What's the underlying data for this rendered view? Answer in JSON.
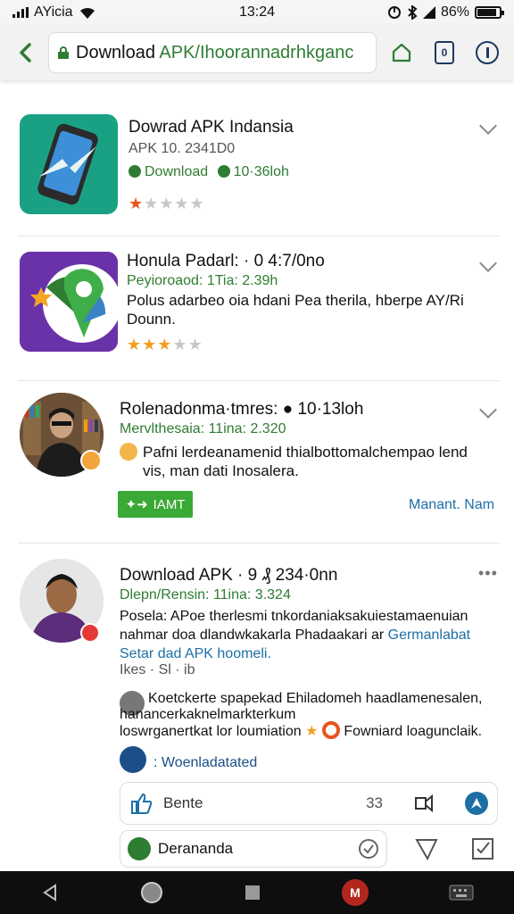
{
  "status": {
    "carrier": "AYicia",
    "time": "13:24",
    "battery": "86%",
    "battery_level": 0.86
  },
  "browser": {
    "url_host": "Download ",
    "url_path": "APK/Ihoorannadrhkganc"
  },
  "feed": [
    {
      "title": "Dowrad APK Indansia",
      "meta": "APK 10. 2341D0",
      "download_label": "Download",
      "download_count": "10·36loh",
      "rating": 1
    },
    {
      "title": "Honula Padarl: · 0 4:7/0no",
      "subtitle": "Peyioroaod: 1Tia: 2.39h",
      "description": "Polus adarbeo oia hdani Pea therila, hberpe AY/Ri Dounn.",
      "rating": 3
    },
    {
      "title": "Rolenadonma·tmres: ● 10·13loh",
      "subtitle": "Mervlthesaia: 11ina: 2.320",
      "description": "Pafni lerdeanamenid thialbottomalchempao lend vis, man dati Inosalera.",
      "button_label": "IAMT",
      "manage_label": "Manant. Nam"
    },
    {
      "title": "Download APK · 9 ₰ 234·0nn",
      "subtitle": "Dlepn/Rensin: 11ina: 3.324",
      "description_line1": "Posela: APoe therlesmi tnkordaniaksakuiestamaenuian",
      "description_line2_black": "nahmar doa dlandwkakarla Phadaakari ar ",
      "description_line2_blue": "Germanlabat",
      "description_line3": "Setar dad APK hoomeli.",
      "reactions": "Ikes · Sl · ib",
      "comment_author_line": "Koetckerte spapekad Ehiladomeh haadlamenesalen,",
      "comment_line2": "hanancerkaknelmarkterkum",
      "comment_green1": "loswrganertkat lor loumiation",
      "comment_green2": "Fowniard loagunclaik.",
      "download_attached": ": Woenladatated",
      "like_label": "Bente",
      "like_count": "33",
      "reply_label": "Derananda"
    }
  ]
}
